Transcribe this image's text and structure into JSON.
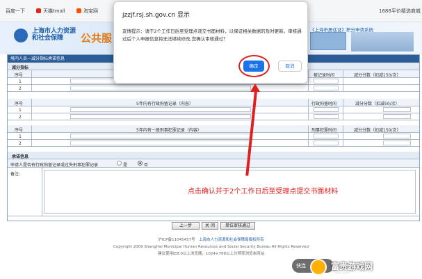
{
  "bookmarks": [
    "百度一下",
    "天猫tmall",
    "淘宝网",
    "1688平价精选商城"
  ],
  "banner": {
    "dept_line1": "上海市人力资源",
    "dept_line2": "和社会保障",
    "public_text": "公共服",
    "right_text": "《上海市居住证》积分申请系统"
  },
  "form": {
    "title": "境内人员—减分指标承诺信息",
    "section_deduct": "减分指标",
    "headers": {
      "seq": "序号",
      "time1": "被记录时间",
      "score1": "减分分数（扣减150/次）",
      "rec2": "5年内有行政拘留记录（内容）",
      "time2": "行政拘留时间",
      "score2": "减分分数（扣减50/次）",
      "rec3": "5年内有一般刑事犯罪记录（内容）",
      "time3": "刑事犯罪时间",
      "score3": "减分分数（扣减150/次）"
    },
    "row_nums": [
      "1",
      "2"
    ],
    "section_promise": "承诺信息",
    "promise_question": "申请人是否有行政拘留记录或过失刑事犯罪记录",
    "opt_yes": "是",
    "opt_no": "否",
    "remark_label": "备注:",
    "buttons": {
      "prev": "上一步",
      "close": "关 闭",
      "submit": "单位审核通过"
    }
  },
  "footer": {
    "icp": "沪ICP备11045457号",
    "owner": "上海市人力资源和社会保障局版权所有",
    "copyright": "Copyright 2009 ShangHai Municipal Human Resources and Social Security Bureau All Rights Reserved",
    "tip": "建议使用IE8.0以上浏览器，1024×768以上分辨率浏览本网站"
  },
  "dialog": {
    "host": "jzzjf.rsj.sh.gov.cn 显示",
    "message": "友情提示：请于2个工作日后至受理点递交书面材料，以保证相关数据的及时更新。审核通过后个人申报信息将无法继续修改,您确认审核通过？",
    "ok": "确定",
    "cancel": "取消"
  },
  "annotation": "点击确认并于2个工作日后至受理点提交书面材料",
  "watermark": {
    "pill": "快连",
    "brand": "富贵游戏网",
    "domain": "xxx.com"
  },
  "colors": {
    "accent": "#1a73e8",
    "annotation": "#e02020",
    "form_header": "#2c5d97"
  }
}
